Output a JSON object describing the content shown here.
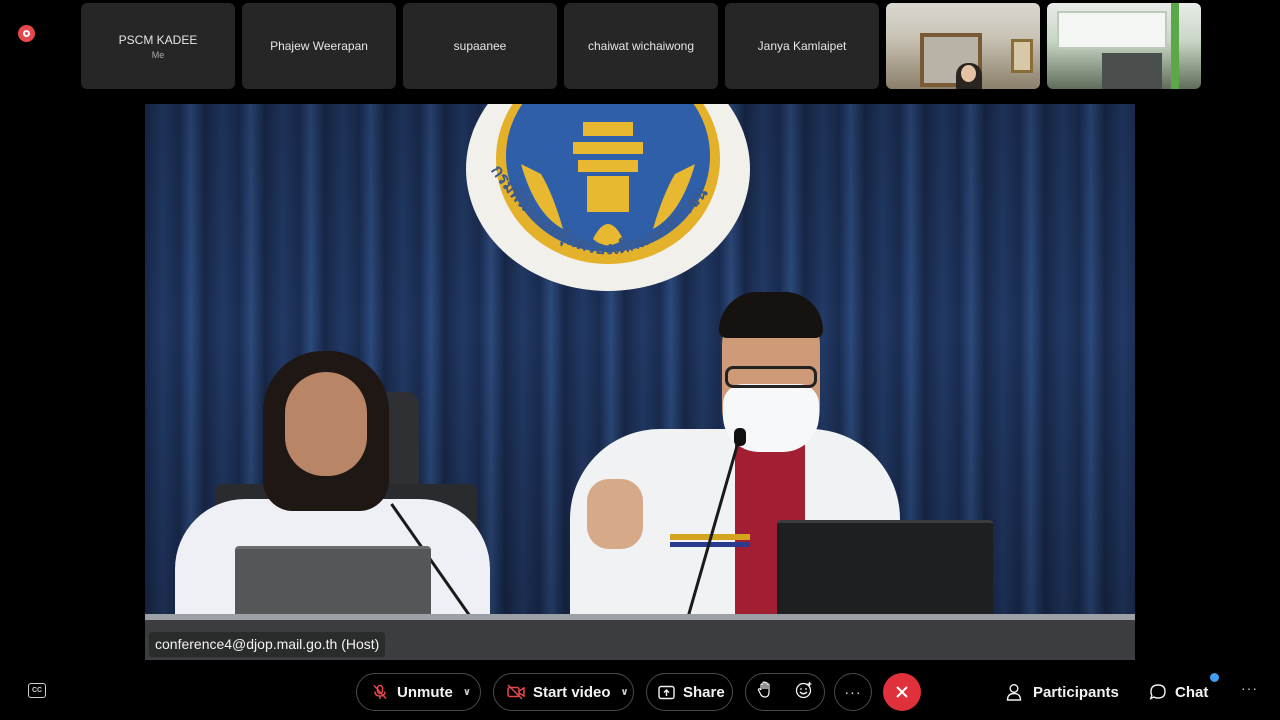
{
  "recording": {
    "icon": "record-indicator-icon",
    "color": "#e5484d"
  },
  "participants": [
    {
      "name": "PSCM KADEE",
      "sub": "Me"
    },
    {
      "name": "Phajew Weerapan",
      "sub": ""
    },
    {
      "name": "supaanee",
      "sub": ""
    },
    {
      "name": "chaiwat wichaiwong",
      "sub": ""
    },
    {
      "name": "Janya Kamlaipet",
      "sub": ""
    }
  ],
  "main_video": {
    "label": "conference4@djop.mail.go.th (Host)",
    "emblem_text": "กรมพินิจและคุ้มครองเด็กและเยาวชน"
  },
  "toolbar": {
    "captions_icon": "closed-captions-icon",
    "unmute_label": "Unmute",
    "start_video_label": "Start video",
    "share_label": "Share",
    "participants_label": "Participants",
    "chat_label": "Chat",
    "more_label": "···",
    "leave_color": "#e0303b",
    "chat_badge_color": "#3f9ef2"
  }
}
